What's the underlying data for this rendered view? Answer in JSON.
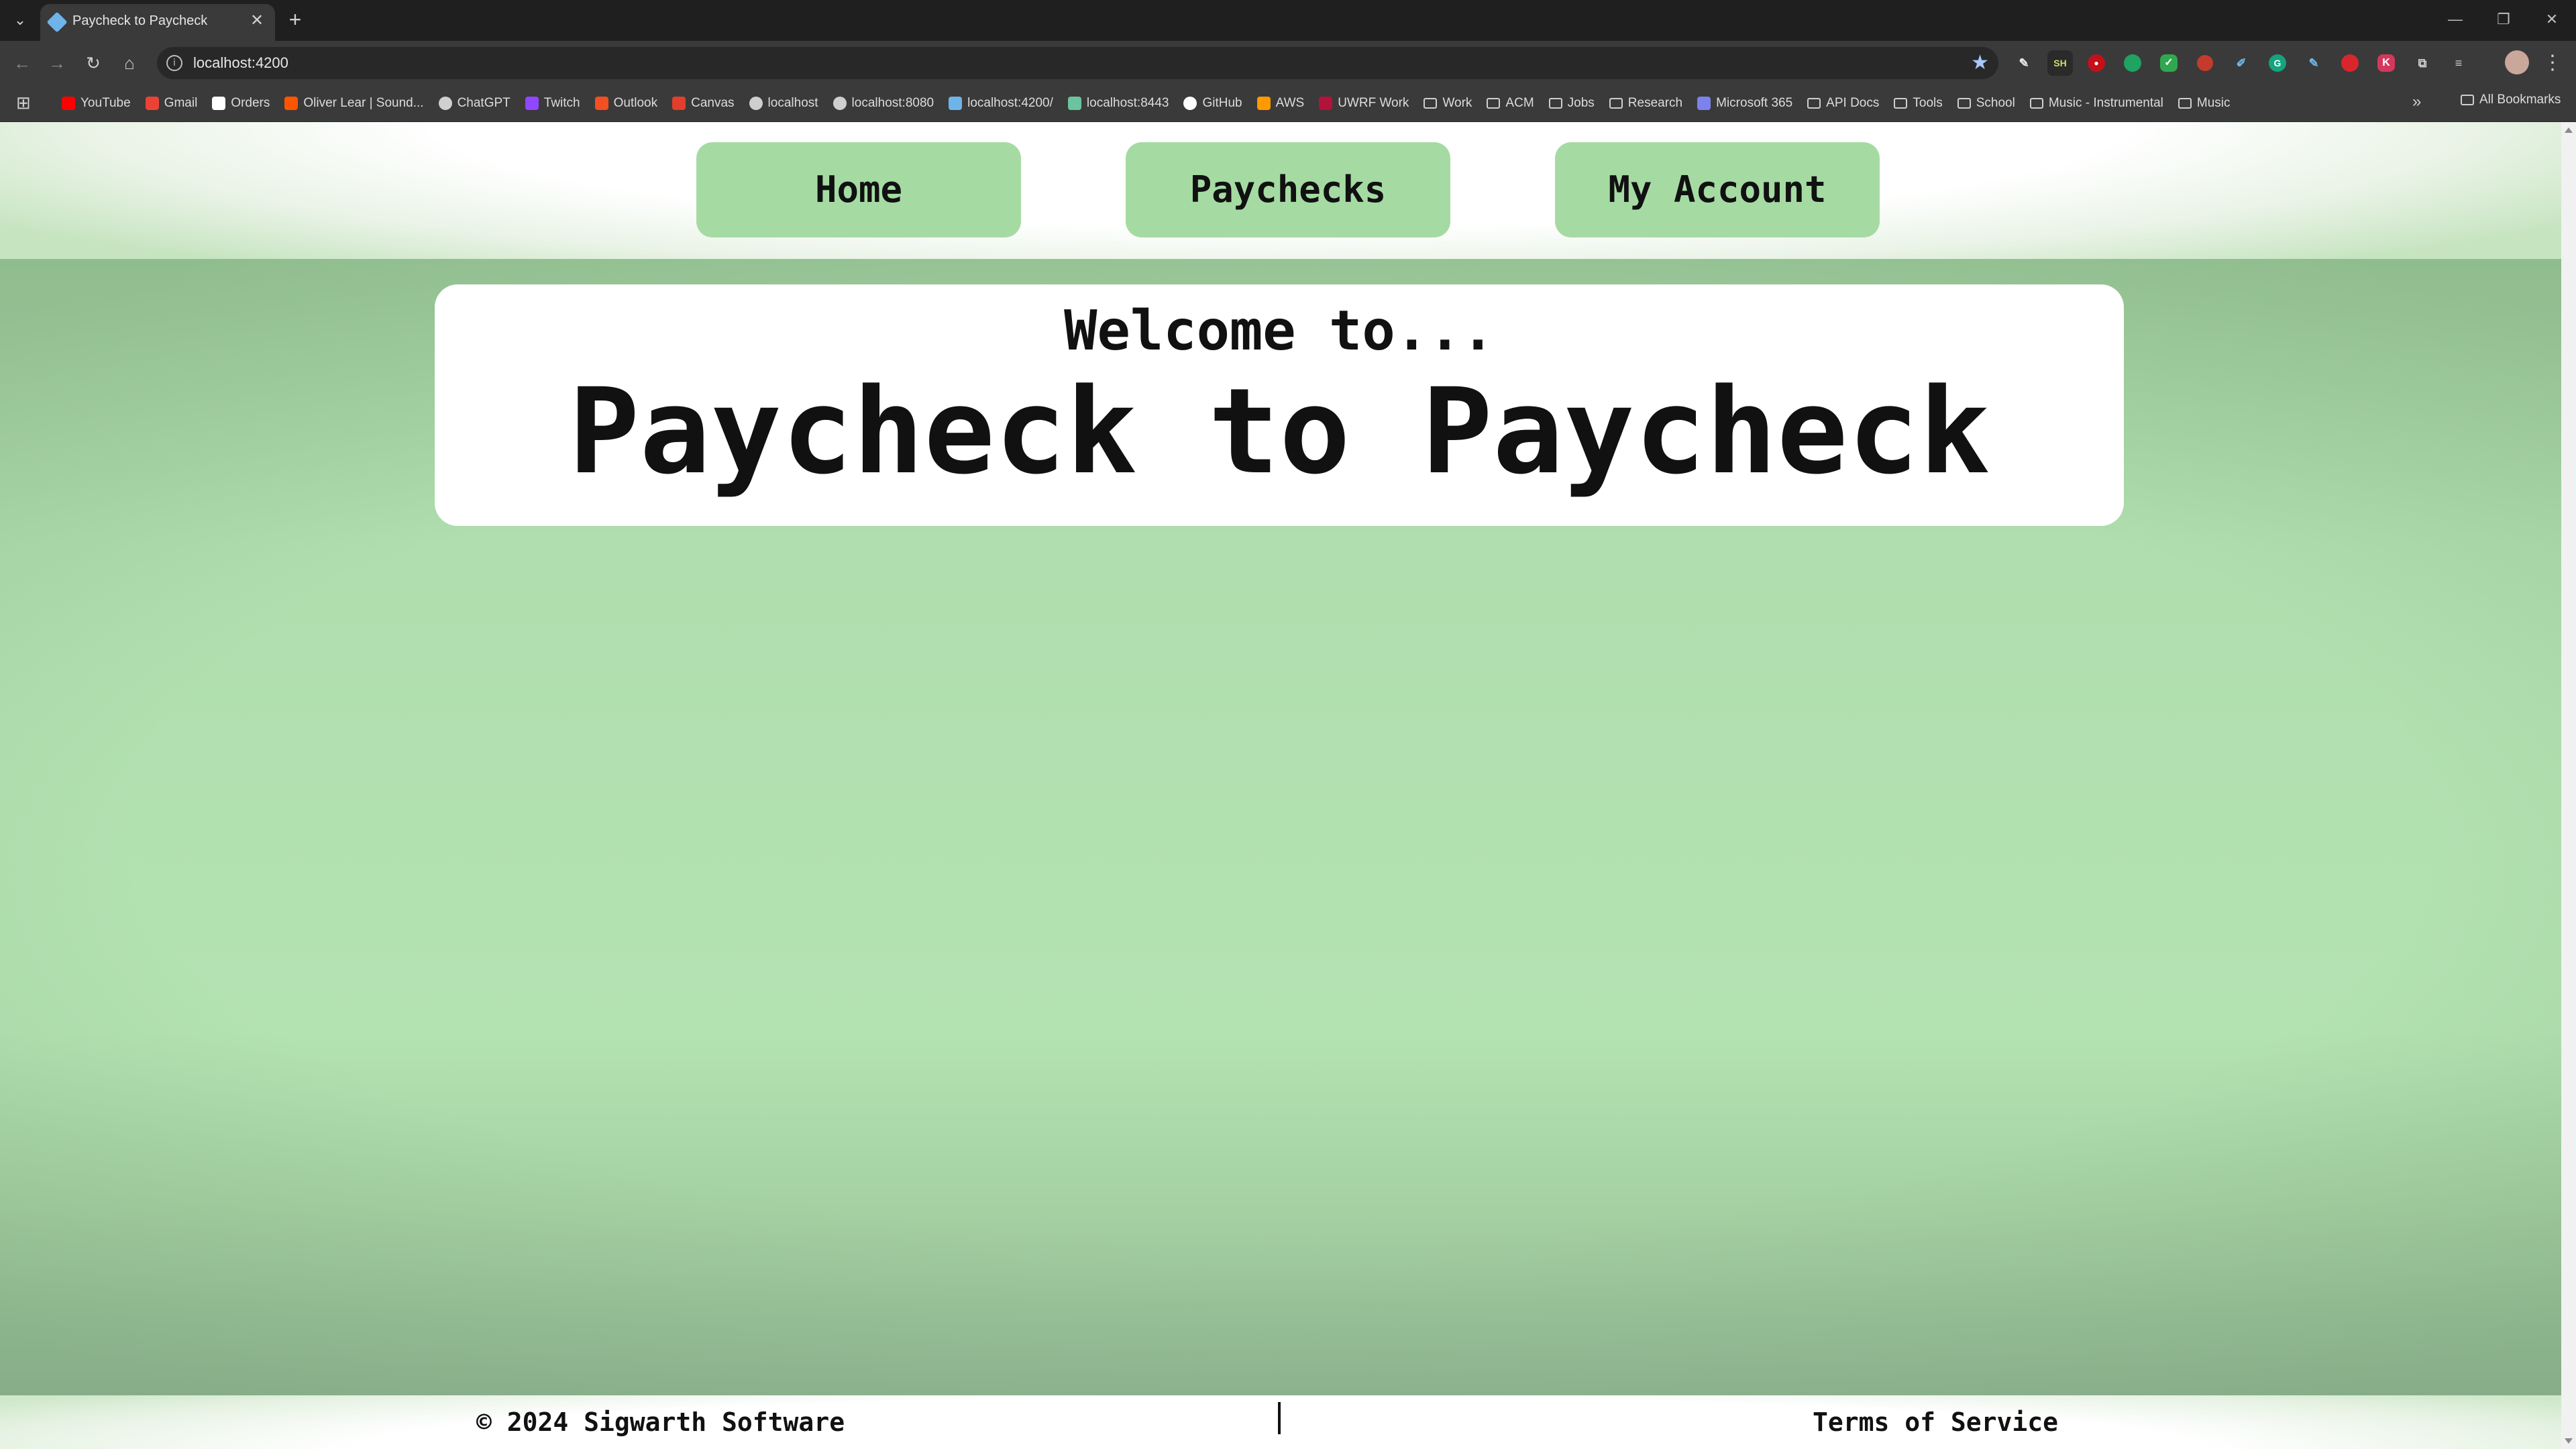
{
  "browser": {
    "tab_title": "Paycheck to Paycheck",
    "tab_close": "✕",
    "new_tab": "+",
    "url": "localhost:4200",
    "window_controls": [
      "—",
      "❐",
      "✕"
    ],
    "bookmarks": [
      {
        "label": "YouTube",
        "icon": "youtube-icon",
        "color": "#ff0000"
      },
      {
        "label": "Gmail",
        "icon": "gmail-icon",
        "color": "#ea4335"
      },
      {
        "label": "Orders",
        "icon": "amazon-icon",
        "color": "#ffffff"
      },
      {
        "label": "Oliver Lear | Sound...",
        "icon": "soundcloud-icon",
        "color": "#ff5500"
      },
      {
        "label": "ChatGPT",
        "icon": "chatgpt-icon",
        "color": "#d0d0d0"
      },
      {
        "label": "Twitch",
        "icon": "twitch-icon",
        "color": "#9146ff"
      },
      {
        "label": "Outlook",
        "icon": "outlook-icon",
        "color": "#f25022"
      },
      {
        "label": "Canvas",
        "icon": "canvas-icon",
        "color": "#e13f2b"
      },
      {
        "label": "localhost",
        "icon": "globe-icon",
        "color": "#cfcfcf"
      },
      {
        "label": "localhost:8080",
        "icon": "globe-icon",
        "color": "#cfcfcf"
      },
      {
        "label": "localhost:4200/",
        "icon": "angular-icon",
        "color": "#6fb4e8"
      },
      {
        "label": "localhost:8443",
        "icon": "shield-icon",
        "color": "#6cc3a0"
      },
      {
        "label": "GitHub",
        "icon": "github-icon",
        "color": "#ffffff"
      },
      {
        "label": "AWS",
        "icon": "aws-icon",
        "color": "#ff9900"
      },
      {
        "label": "UWRF Work",
        "icon": "uwrf-icon",
        "color": "#b3123a"
      },
      {
        "label": "Work",
        "icon": "folder-icon",
        "color": ""
      },
      {
        "label": "ACM",
        "icon": "folder-icon",
        "color": ""
      },
      {
        "label": "Jobs",
        "icon": "folder-icon",
        "color": ""
      },
      {
        "label": "Research",
        "icon": "folder-icon",
        "color": ""
      },
      {
        "label": "Microsoft 365",
        "icon": "microsoft365-icon",
        "color": "#7b83eb"
      },
      {
        "label": "API Docs",
        "icon": "folder-icon",
        "color": ""
      },
      {
        "label": "Tools",
        "icon": "folder-icon",
        "color": ""
      },
      {
        "label": "School",
        "icon": "folder-icon",
        "color": ""
      },
      {
        "label": "Music - Instrumental",
        "icon": "folder-icon",
        "color": ""
      },
      {
        "label": "Music",
        "icon": "folder-icon",
        "color": ""
      }
    ],
    "all_bookmarks": "All Bookmarks"
  },
  "nav": {
    "home": "Home",
    "paychecks": "Paychecks",
    "account": "My Account"
  },
  "hero": {
    "welcome": "Welcome to...",
    "title": "Paycheck to Paycheck"
  },
  "footer": {
    "copyright": "© 2024 Sigwarth Software",
    "terms": "Terms of Service"
  },
  "colors": {
    "nav_button": "#a5dba3",
    "page_green": "#b4e3b2"
  }
}
